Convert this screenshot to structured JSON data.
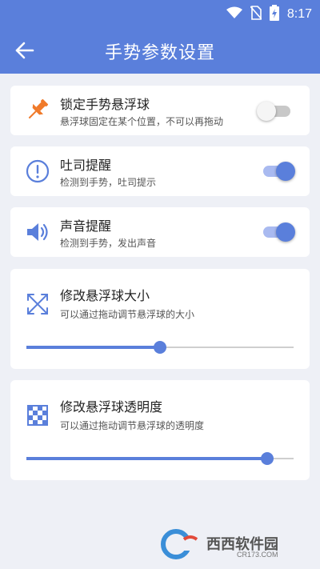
{
  "status_bar": {
    "time": "8:17",
    "icons": [
      "wifi-icon",
      "no-sim-icon",
      "battery-charging-icon"
    ]
  },
  "app_bar": {
    "title": "手势参数设置",
    "back_icon": "arrow-left-icon",
    "background": "#5a7fdb"
  },
  "settings": [
    {
      "icon": "pushpin-icon",
      "title": "锁定手势悬浮球",
      "subtitle": "悬浮球固定在某个位置，不可以再拖动",
      "toggle_on": false
    },
    {
      "icon": "exclamation-circle-icon",
      "title": "吐司提醒",
      "subtitle": "检测到手势，吐司提示",
      "toggle_on": true
    },
    {
      "icon": "speaker-icon",
      "title": "声音提醒",
      "subtitle": "检测到手势，发出声音",
      "toggle_on": true
    }
  ],
  "sliders": [
    {
      "icon": "expand-arrows-icon",
      "title": "修改悬浮球大小",
      "subtitle": "可以通过拖动调节悬浮球的大小",
      "value_fraction": 0.5
    },
    {
      "icon": "checkerboard-icon",
      "title": "修改悬浮球透明度",
      "subtitle": "可以通过拖动调节悬浮球的透明度",
      "value_fraction": 0.9
    }
  ],
  "colors": {
    "accent": "#5a7fdb",
    "pushpin": "#f07a2a",
    "page_background": "#eef0f6"
  },
  "watermark": {
    "text": "西西软件园",
    "site": "CR173.COM"
  }
}
